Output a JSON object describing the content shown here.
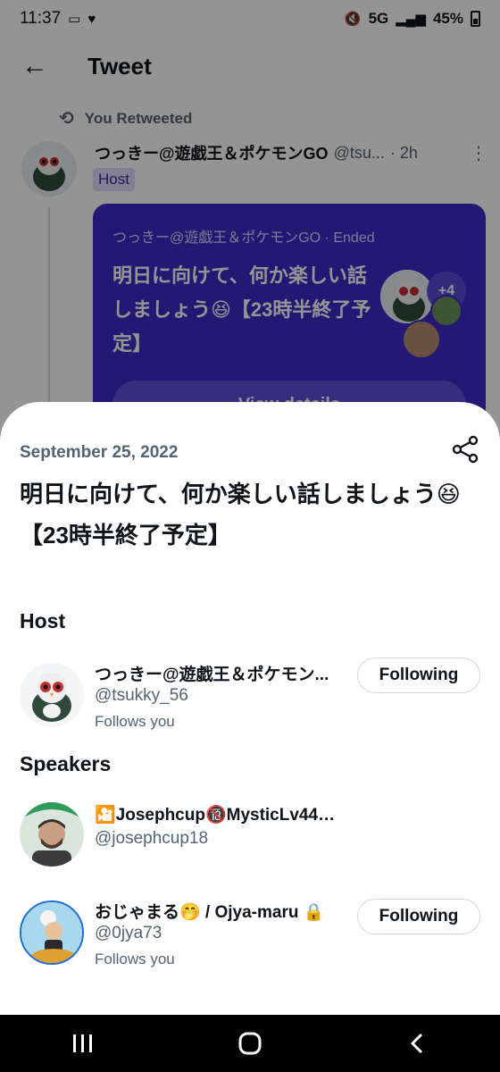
{
  "status_bar": {
    "time": "11:37",
    "network": "5G",
    "battery": "45%"
  },
  "header": {
    "title": "Tweet"
  },
  "tweet": {
    "retweet_label": "You Retweeted",
    "author_name": "つっきー@遊戯王＆ポケモンGO",
    "author_handle": "@tsu...",
    "time": "· 2h",
    "host_tag": "Host",
    "space_card": {
      "meta": "つっきー@遊戯王＆ポケモンGO · Ended",
      "title": "明日に向けて、何か楽しい話しましょう😆【23時半終了予定】",
      "extra_count": "+4",
      "view_button": "View details"
    }
  },
  "sheet": {
    "date": "September 25, 2022",
    "title": "明日に向けて、何か楽しい話しましょう😆【23時半終了予定】",
    "host_heading": "Host",
    "speakers_heading": "Speakers",
    "host": {
      "name": "つっきー@遊戯王＆ポケモン...",
      "handle": "@tsukky_56",
      "follows_you": "Follows you",
      "button": "Following"
    },
    "speakers": [
      {
        "name": "🎦Josephcup🔞MysticLv44🌬️🛎️",
        "handle": "@josephcup18"
      },
      {
        "name": "おじゃまる🤭 / Ojya-maru 🔒",
        "handle": "@0jya73",
        "follows_you": "Follows you",
        "button": "Following"
      }
    ]
  },
  "icons": {
    "back": "arrow-left-icon",
    "retweet": "retweet-icon",
    "share": "share-icon",
    "more": "more-vertical-icon"
  }
}
